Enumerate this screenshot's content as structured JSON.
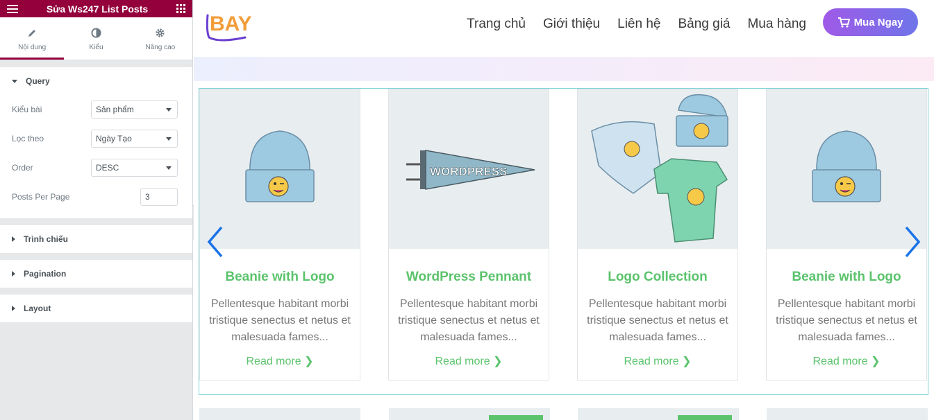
{
  "editor": {
    "title": "Sửa Ws247 List Posts",
    "tabs": [
      {
        "label": "Nội dung",
        "icon": "pencil-icon"
      },
      {
        "label": "Kiểu",
        "icon": "contrast-icon"
      },
      {
        "label": "Nâng cao",
        "icon": "gear-icon"
      }
    ],
    "query": {
      "label": "Query",
      "fields": [
        {
          "label": "Kiểu bài",
          "value": "Sản phẩm"
        },
        {
          "label": "Lọc theo",
          "value": "Ngày Tạo"
        },
        {
          "label": "Order",
          "value": "DESC"
        }
      ],
      "posts_per_page": {
        "label": "Posts Per Page",
        "value": "3"
      }
    },
    "sections": [
      "Trình chiếu",
      "Pagination",
      "Layout"
    ]
  },
  "site": {
    "logo": "BAY",
    "nav": [
      "Trang chủ",
      "Giới thiệu",
      "Liên hệ",
      "Bảng giá",
      "Mua hàng"
    ],
    "buy_button": "Mua Ngay",
    "accent": "#5bc36c",
    "cards": [
      {
        "title": "Beanie with Logo",
        "excerpt": "Pellentesque habitant morbi tristique senectus et netus et malesuada fames...",
        "more": "Read more",
        "image": "beanie-image"
      },
      {
        "title": "WordPress Pennant",
        "excerpt": "Pellentesque habitant morbi tristique senectus et netus et malesuada fames...",
        "more": "Read more",
        "image": "pennant-image"
      },
      {
        "title": "Logo Collection",
        "excerpt": "Pellentesque habitant morbi tristique senectus et netus et malesuada fames...",
        "more": "Read more",
        "image": "collection-image"
      },
      {
        "title": "Beanie with Logo",
        "excerpt": "Pellentesque habitant morbi tristique senectus et netus et malesuada fames...",
        "more": "Read more",
        "image": "beanie-image"
      }
    ]
  }
}
